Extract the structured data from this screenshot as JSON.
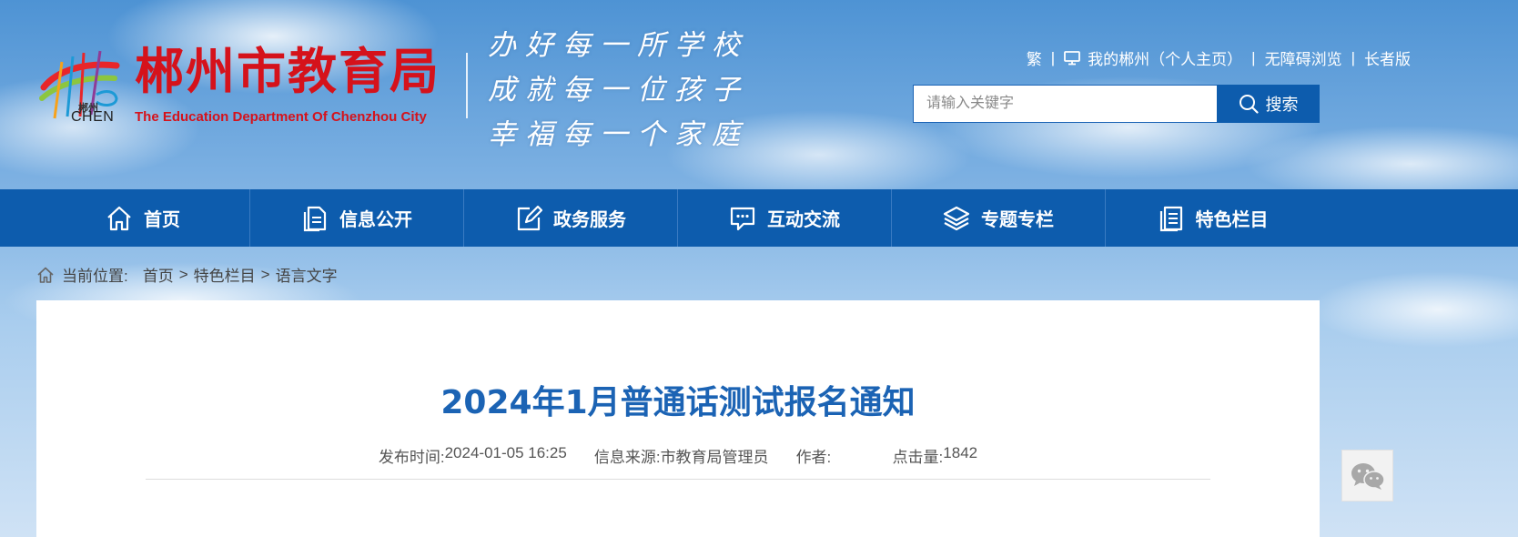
{
  "header": {
    "logo_cn": "郴州",
    "logo_en": "CHEN",
    "title_cn": "郴州市教育局",
    "title_en": "The Education Department Of Chenzhou City",
    "slogans": [
      "办好每一所学校",
      "成就每一位孩子",
      "幸福每一个家庭"
    ],
    "top_links": {
      "traditional": "繁",
      "my_chenzhou": "我的郴州（个人主页）",
      "accessibility": "无障碍浏览",
      "elder": "长者版"
    },
    "search": {
      "placeholder": "请输入关键字",
      "button_label": "搜索"
    }
  },
  "nav": {
    "items": [
      {
        "label": "首页",
        "icon": "home-icon"
      },
      {
        "label": "信息公开",
        "icon": "document-icon"
      },
      {
        "label": "政务服务",
        "icon": "edit-icon"
      },
      {
        "label": "互动交流",
        "icon": "chat-icon"
      },
      {
        "label": "专题专栏",
        "icon": "layers-icon"
      },
      {
        "label": "特色栏目",
        "icon": "list-document-icon"
      }
    ]
  },
  "breadcrumb": {
    "label": "当前位置:",
    "items": [
      "首页",
      "特色栏目",
      "语言文字"
    ]
  },
  "article": {
    "title": "2024年1月普通话测试报名通知",
    "publish_label": "发布时间:",
    "publish_time": "2024-01-05 16:25",
    "source_label": "信息来源:",
    "source": "市教育局管理员",
    "author_label": "作者:",
    "author": "",
    "views_label": "点击量:",
    "views": "1842"
  },
  "colors": {
    "brand_red": "#d5121b",
    "nav_blue": "#0d5cad",
    "title_blue": "#1b63b4"
  }
}
